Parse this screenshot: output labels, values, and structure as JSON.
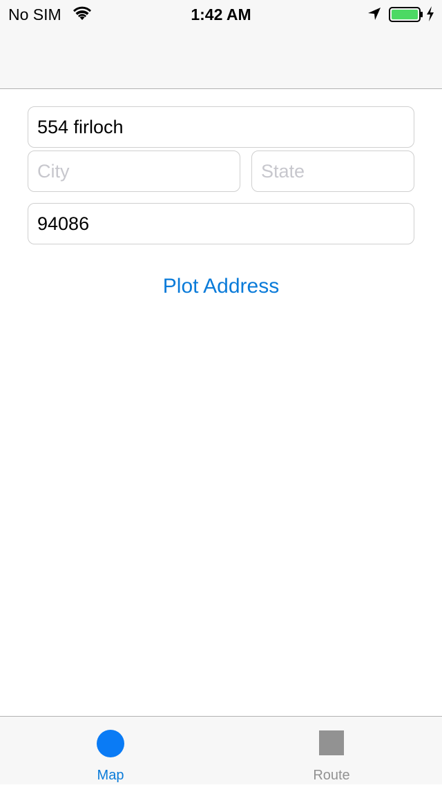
{
  "status_bar": {
    "carrier": "No SIM",
    "time": "1:42 AM",
    "battery_color": "#4cd964",
    "icons": [
      "wifi-icon",
      "location-arrow-icon",
      "battery-icon",
      "charging-bolt-icon"
    ]
  },
  "form": {
    "address": {
      "value": "554 firloch",
      "placeholder": ""
    },
    "city": {
      "value": "",
      "placeholder": "City"
    },
    "state": {
      "value": "",
      "placeholder": "State"
    },
    "zip": {
      "value": "94086",
      "placeholder": ""
    },
    "plot_label": "Plot Address"
  },
  "tab_bar": {
    "tabs": [
      {
        "label": "Map",
        "icon": "circle-icon",
        "selected": true,
        "color": "#0a7bd9"
      },
      {
        "label": "Route",
        "icon": "square-icon",
        "selected": false,
        "color": "#929292"
      }
    ]
  },
  "colors": {
    "accent": "#0a7bd9",
    "bar_background": "#f7f7f7",
    "placeholder": "#c7c7cd"
  }
}
